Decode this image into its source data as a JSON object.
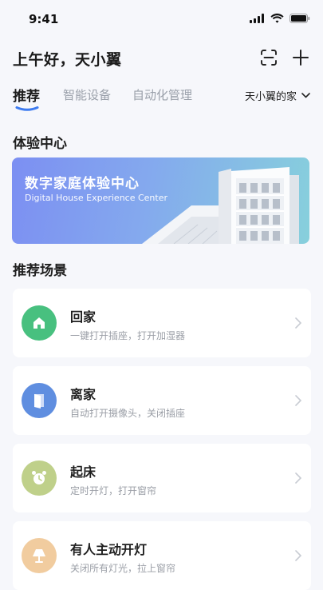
{
  "status_bar": {
    "time": "9:41"
  },
  "header": {
    "greeting": "上午好，天小翼",
    "scan_icon": "scan-icon",
    "add_icon": "plus-icon"
  },
  "tabs": [
    {
      "label": "推荐",
      "active": true
    },
    {
      "label": "智能设备",
      "active": false
    },
    {
      "label": "自动化管理",
      "active": false
    }
  ],
  "home_selector": {
    "label": "天小翼的家"
  },
  "experience": {
    "section_title": "体验中心",
    "banner_title": "数字家庭体验中心",
    "banner_subtitle": "Digital House Experience Center"
  },
  "scenes": {
    "section_title": "推荐场景",
    "items": [
      {
        "title": "回家",
        "desc": "一键打开插座，打开加湿器",
        "icon": "home-icon",
        "icon_color": "#48c07f"
      },
      {
        "title": "离家",
        "desc": "自动打开摄像头，关闭插座",
        "icon": "door-icon",
        "icon_color": "#5f8ee0"
      },
      {
        "title": "起床",
        "desc": "定时开灯，打开窗帘",
        "icon": "alarm-clock-icon",
        "icon_color": "#bfd08a"
      },
      {
        "title": "有人主动开灯",
        "desc": "关闭所有灯光，拉上窗帘",
        "icon": "lamp-icon",
        "icon_color": "#f1cc9f"
      }
    ]
  },
  "colors": {
    "accent": "#3d7bf0",
    "background": "#f6f7fb"
  }
}
